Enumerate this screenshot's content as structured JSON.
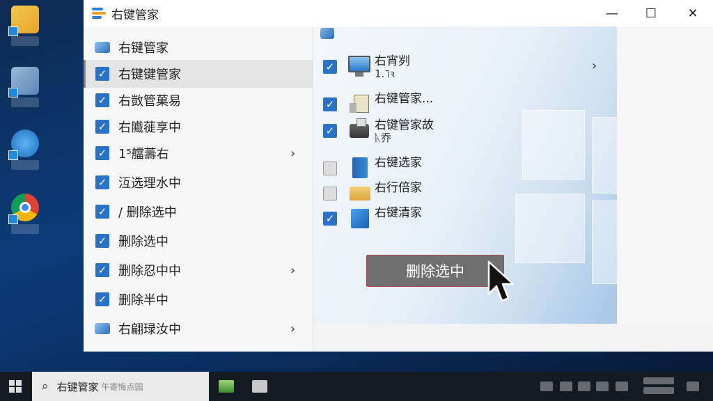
{
  "window": {
    "title": "右键管家",
    "minimize": "—",
    "maximize": "☐",
    "close": "✕"
  },
  "left_menu": {
    "items": [
      {
        "label": "右键管家",
        "type": "app"
      },
      {
        "label": "右键键管家",
        "type": "checked",
        "selected": true
      },
      {
        "label": "右敳管菓易",
        "type": "checked"
      },
      {
        "label": "右隵蓰享中",
        "type": "checked"
      },
      {
        "label": "1⁵艡薵右",
        "type": "checked",
        "submenu": true
      },
      {
        "label": "沍选理水中",
        "type": "checked"
      },
      {
        "label": "/ 删除选中",
        "type": "checked"
      },
      {
        "label": "删除选中",
        "type": "checked"
      },
      {
        "label": "删除忍中中",
        "type": "checked",
        "submenu": true
      },
      {
        "label": "删除半中",
        "type": "checked"
      },
      {
        "label": "右翩琭汝中",
        "type": "app",
        "submenu": true
      }
    ],
    "check_glyph": "✓",
    "chevron_glyph": "›"
  },
  "right_list": {
    "items": [
      {
        "label": "右宵刿",
        "sub": "1.˥ꝛ",
        "checked": true,
        "icon": "monitor-icon",
        "submenu": true
      },
      {
        "label": "右键管家...",
        "checked": true,
        "icon": "calculator-icon"
      },
      {
        "label": "右键管家故",
        "sub": "ᚣ乔",
        "checked": true,
        "icon": "printer-icon"
      },
      {
        "label": "右键选家",
        "checked": false,
        "icon": "book-icon"
      },
      {
        "label": "右行倍家",
        "checked": false,
        "icon": "folder-icon"
      },
      {
        "label": "右键清家",
        "checked": true,
        "icon": "blue-box-icon"
      }
    ]
  },
  "action_button": {
    "label": "删除选中"
  },
  "taskbar": {
    "search_value": "右键管家",
    "search_placeholder": "午寄悔点园"
  },
  "colors": {
    "checkbox": "#2a72c8",
    "button": "#6f6f6f",
    "button_border": "#d03030"
  }
}
